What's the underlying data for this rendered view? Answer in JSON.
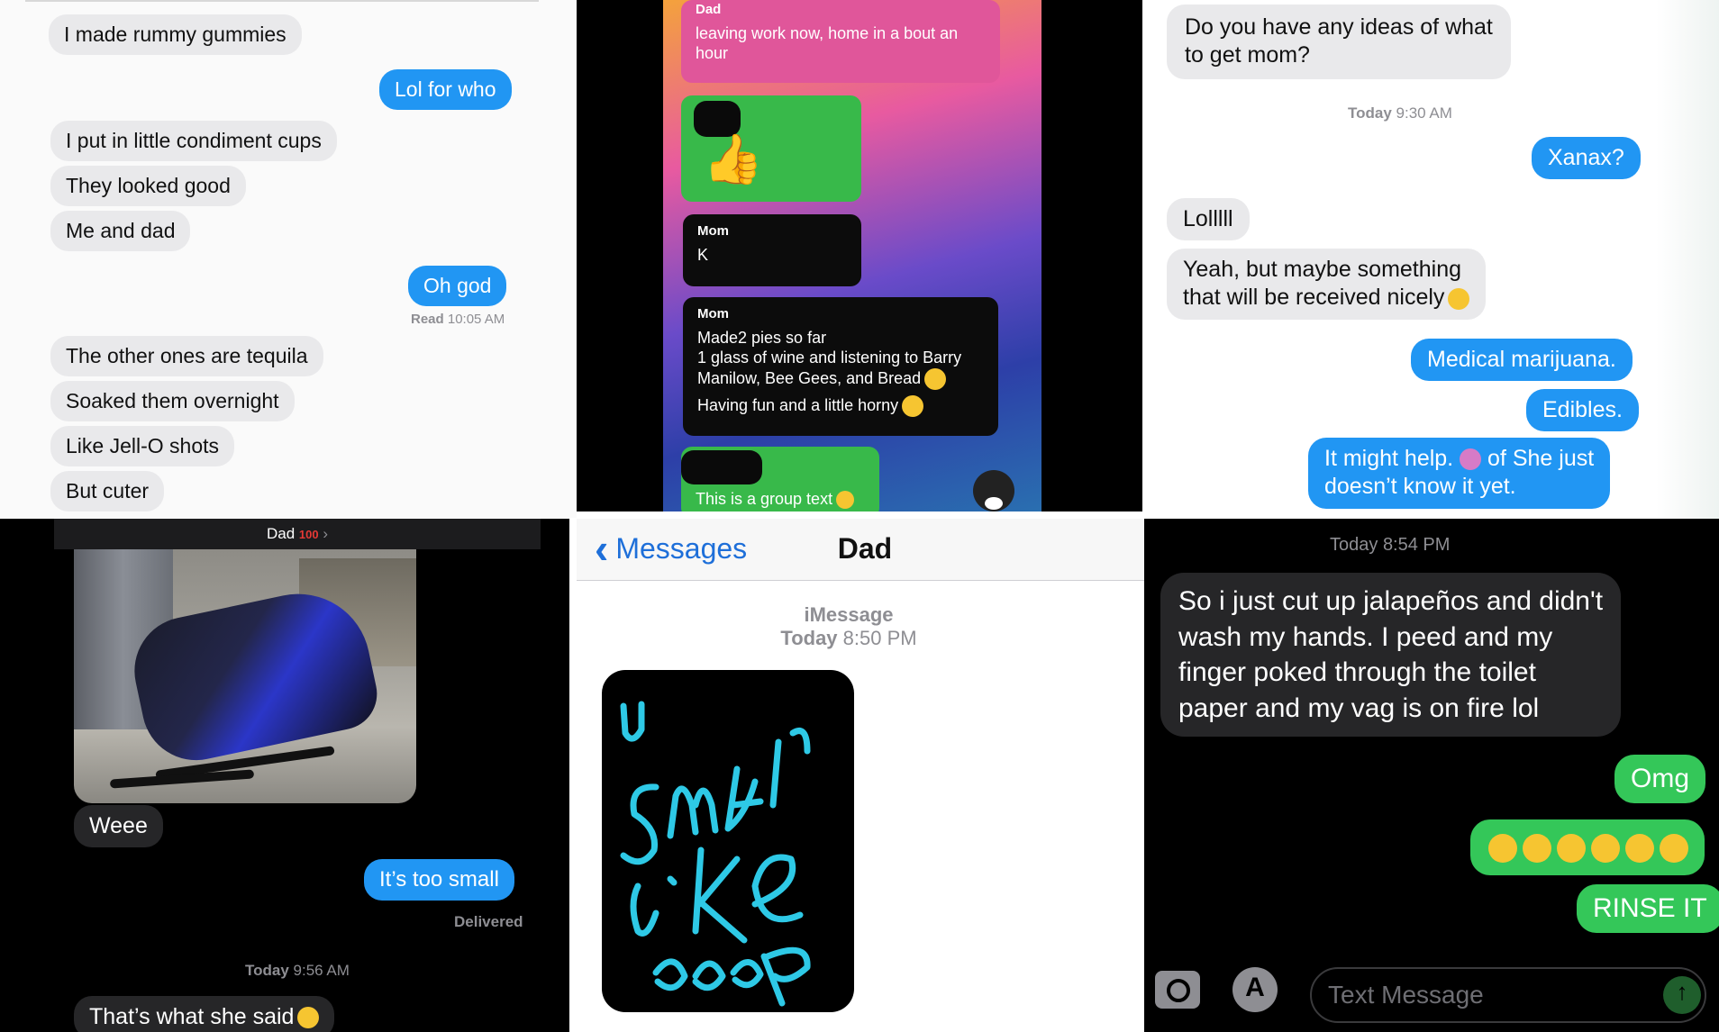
{
  "p1": {
    "messages": [
      "I made rummy gummies",
      "Lol for who",
      "I put in little condiment cups",
      "They looked good",
      "Me and dad",
      "Oh god",
      "The other ones are tequila",
      "Soaked them overnight",
      "Like Jell-O shots",
      "But cuter"
    ],
    "read_label": "Read",
    "read_time": "10:05 AM"
  },
  "p2": {
    "m1_sender": "Dad",
    "m1_lines": [
      "leaving work now, home in a bout an",
      "hour"
    ],
    "m2_sender": "Mom",
    "m2_text": "K",
    "m3_sender": "Mom",
    "m3_lines": [
      "Made2 pies so far",
      "1 glass of wine and listening to Barry",
      "Manilow, Bee Gees, and Bread",
      "Having fun and a little horny"
    ],
    "m4_text": "This is a group text"
  },
  "p3": {
    "q_lines": [
      "Do you have any ideas of what",
      "to get mom?"
    ],
    "time_day": "Today",
    "time": "9:30 AM",
    "xanax": "Xanax?",
    "lol": "Lolllll",
    "yeah_lines": [
      "Yeah, but maybe something",
      "that will be received nicely"
    ],
    "med": "Medical marijuana.",
    "edibles": "Edibles.",
    "help_lines": [
      "It might help.",
      "of She just",
      "doesn’t know it yet."
    ]
  },
  "p4": {
    "contact": "Dad",
    "weee": "Weee",
    "too_small": "It’s too small",
    "delivered": "Delivered",
    "time_day": "Today",
    "time": "9:56 AM",
    "last": "That’s what she said"
  },
  "p5": {
    "back": "Messages",
    "title": "Dad",
    "service": "iMessage",
    "time_day": "Today",
    "time": "8:50 PM",
    "drawing_text": "u smell like poop"
  },
  "p6": {
    "time_day": "Today",
    "time": "8:54 PM",
    "msg_lines": [
      "So i just cut up jalapeños and didn't",
      "wash my hands. I peed and my",
      "finger poked through the toilet",
      "paper and my vag is on fire lol"
    ],
    "omg": "Omg",
    "rinse": "RINSE IT",
    "placeholder": "Text Message"
  },
  "colors": {
    "imessage_blue": "#2196f3",
    "sms_green": "#34c759",
    "incoming_light": "#e9e9eb",
    "incoming_dark": "#262628"
  }
}
